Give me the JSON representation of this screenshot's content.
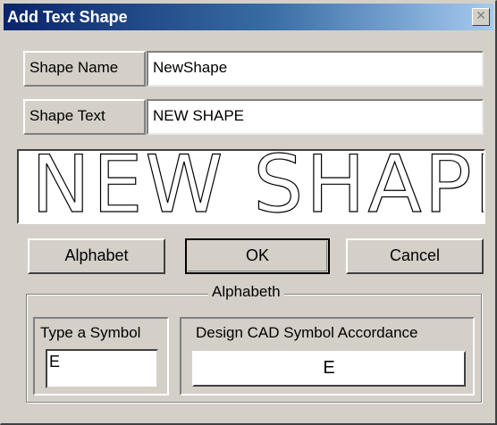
{
  "window": {
    "title": "Add Text Shape",
    "close_glyph": "✕"
  },
  "shape_name": {
    "label": "Shape Name",
    "value": "NewShape"
  },
  "shape_text": {
    "label": "Shape Text",
    "value": "NEW SHAPE"
  },
  "preview": {
    "text": "NEW  SHAPE"
  },
  "buttons": {
    "alphabet": "Alphabet",
    "ok": "OK",
    "cancel": "Cancel"
  },
  "alphabet_group": {
    "title": "Alphabeth",
    "type_symbol_label": "Type a Symbol",
    "type_symbol_value": "E",
    "accordance_label": "Design CAD Symbol Accordance",
    "accordance_value": "E"
  }
}
